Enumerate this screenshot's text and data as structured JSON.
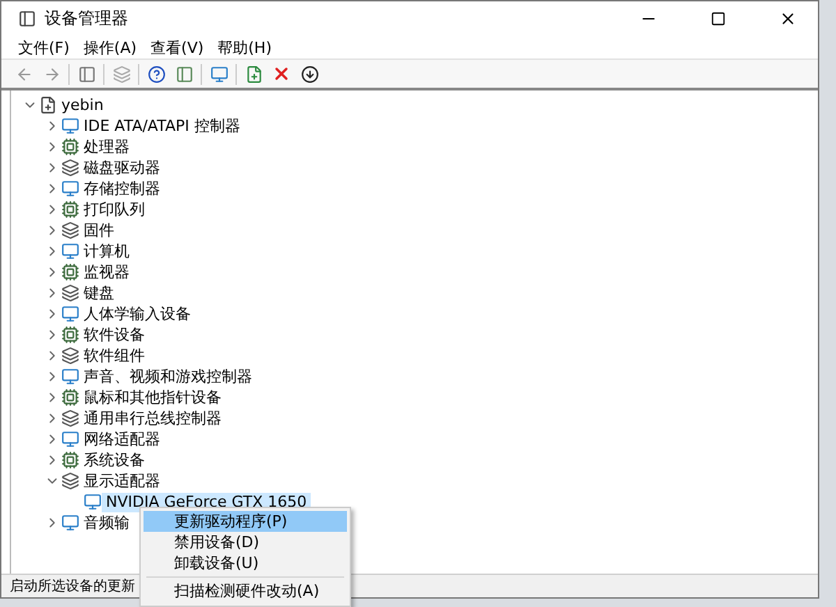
{
  "window": {
    "title": "设备管理器"
  },
  "menu_bar": [
    "文件(F)",
    "操作(A)",
    "查看(V)",
    "帮助(H)"
  ],
  "tree": [
    {
      "label": "yebin",
      "expanded": true,
      "selected": false,
      "children": [
        {
          "label": "IDE ATA/ATAPI 控制器",
          "expanded": false,
          "selected": false
        },
        {
          "label": "处理器",
          "expanded": false,
          "selected": false
        },
        {
          "label": "磁盘驱动器",
          "expanded": false,
          "selected": false
        },
        {
          "label": "存储控制器",
          "expanded": false,
          "selected": false
        },
        {
          "label": "打印队列",
          "expanded": false,
          "selected": false
        },
        {
          "label": "固件",
          "expanded": false,
          "selected": false
        },
        {
          "label": "计算机",
          "expanded": false,
          "selected": false
        },
        {
          "label": "监视器",
          "expanded": false,
          "selected": false
        },
        {
          "label": "键盘",
          "expanded": false,
          "selected": false
        },
        {
          "label": "人体学输入设备",
          "expanded": false,
          "selected": false
        },
        {
          "label": "软件设备",
          "expanded": false,
          "selected": false
        },
        {
          "label": "软件组件",
          "expanded": false,
          "selected": false
        },
        {
          "label": "声音、视频和游戏控制器",
          "expanded": false,
          "selected": false
        },
        {
          "label": "鼠标和其他指针设备",
          "expanded": false,
          "selected": false
        },
        {
          "label": "通用串行总线控制器",
          "expanded": false,
          "selected": false
        },
        {
          "label": "网络适配器",
          "expanded": false,
          "selected": false
        },
        {
          "label": "系统设备",
          "expanded": false,
          "selected": false
        },
        {
          "label": "显示适配器",
          "expanded": true,
          "selected": false,
          "children": [
            {
              "label": "NVIDIA GeForce GTX 1650",
              "selected": true
            }
          ]
        },
        {
          "label": "音频输",
          "expanded": false,
          "selected": false
        }
      ]
    }
  ],
  "context_menu": [
    {
      "label": "更新驱动程序(P)",
      "selected": true
    },
    {
      "label": "禁用设备(D)",
      "selected": false
    },
    {
      "label": "卸载设备(U)",
      "selected": false
    },
    {
      "kind": "separator"
    },
    {
      "label": "扫描检测硬件改动(A)",
      "selected": false
    }
  ],
  "status_bar": "启动所选设备的更新"
}
